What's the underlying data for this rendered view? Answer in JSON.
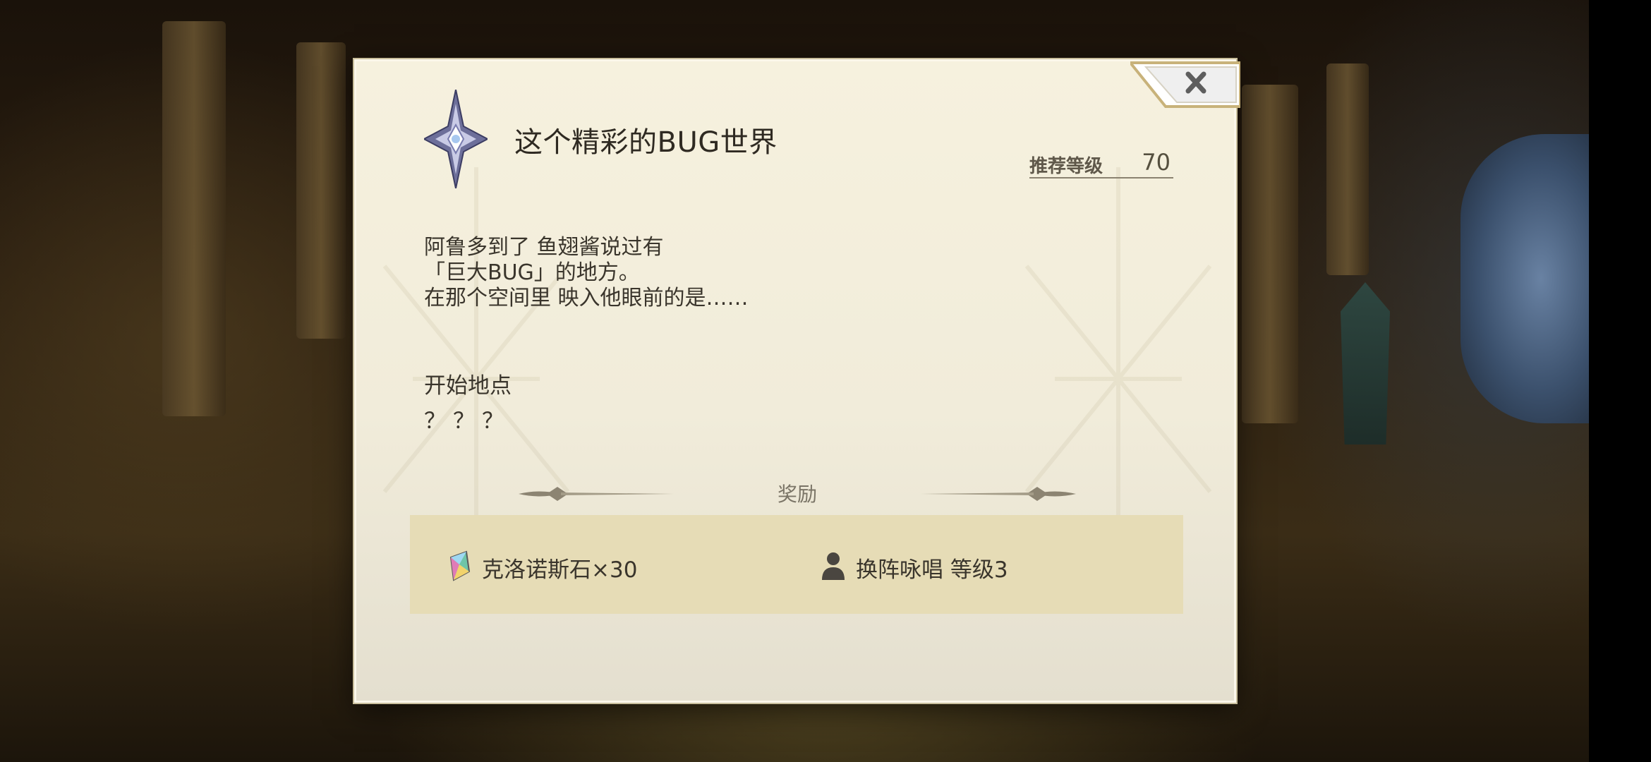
{
  "dialog": {
    "title": "这个精彩的BUG世界",
    "recommended_level_label": "推荐等级",
    "recommended_level_value": "70",
    "description_lines": [
      "阿鲁多到了 鱼翅酱说过有",
      "「巨大BUG」的地方。",
      "在那个空间里 映入他眼前的是……"
    ],
    "start_location_label": "开始地点",
    "start_location_value": "？？？",
    "reward_header": "奖励",
    "rewards": [
      {
        "icon": "crystal-stone-icon",
        "text": "克洛诺斯石×30"
      },
      {
        "icon": "person-icon",
        "text": "换阵咏唱 等级3"
      }
    ],
    "close_icon": "close-icon"
  },
  "colors": {
    "dialog_bg": "#f3eedc",
    "reward_panel_bg": "#e6dcb6",
    "text_main": "#3a352c",
    "text_muted": "#7a7466"
  }
}
